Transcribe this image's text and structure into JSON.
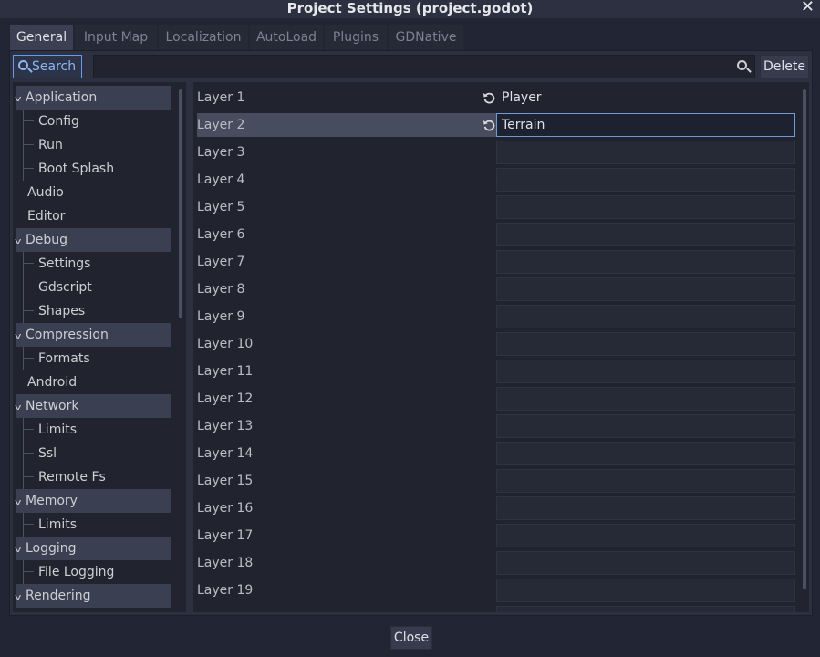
{
  "window": {
    "title": "Project Settings (project.godot)",
    "close_glyph": "✕"
  },
  "tabs": [
    {
      "label": "General"
    },
    {
      "label": "Input Map"
    },
    {
      "label": "Localization"
    },
    {
      "label": "AutoLoad"
    },
    {
      "label": "Plugins"
    },
    {
      "label": "GDNative"
    }
  ],
  "toolbar": {
    "search_label": "Search",
    "search_value": "",
    "delete_label": "Delete"
  },
  "tree": {
    "items": [
      {
        "label": "Application",
        "kind": "section"
      },
      {
        "label": "Config",
        "kind": "leaf"
      },
      {
        "label": "Run",
        "kind": "leaf"
      },
      {
        "label": "Boot Splash",
        "kind": "leaf"
      },
      {
        "label": "Audio",
        "kind": "top"
      },
      {
        "label": "Editor",
        "kind": "top"
      },
      {
        "label": "Debug",
        "kind": "section"
      },
      {
        "label": "Settings",
        "kind": "leaf"
      },
      {
        "label": "Gdscript",
        "kind": "leaf"
      },
      {
        "label": "Shapes",
        "kind": "leaf"
      },
      {
        "label": "Compression",
        "kind": "section"
      },
      {
        "label": "Formats",
        "kind": "leaf"
      },
      {
        "label": "Android",
        "kind": "top"
      },
      {
        "label": "Network",
        "kind": "section"
      },
      {
        "label": "Limits",
        "kind": "leaf"
      },
      {
        "label": "Ssl",
        "kind": "leaf"
      },
      {
        "label": "Remote Fs",
        "kind": "leaf"
      },
      {
        "label": "Memory",
        "kind": "section"
      },
      {
        "label": "Limits",
        "kind": "leaf"
      },
      {
        "label": "Logging",
        "kind": "section"
      },
      {
        "label": "File Logging",
        "kind": "leaf"
      },
      {
        "label": "Rendering",
        "kind": "section"
      }
    ]
  },
  "layers": {
    "rows": [
      {
        "label": "Layer 1",
        "value": "Player",
        "revert": true,
        "selected": false,
        "editing": false
      },
      {
        "label": "Layer 2",
        "value": "Terrain",
        "revert": true,
        "selected": true,
        "editing": true
      },
      {
        "label": "Layer 3",
        "value": "",
        "revert": false,
        "selected": false,
        "editing": false
      },
      {
        "label": "Layer 4",
        "value": "",
        "revert": false,
        "selected": false,
        "editing": false
      },
      {
        "label": "Layer 5",
        "value": "",
        "revert": false,
        "selected": false,
        "editing": false
      },
      {
        "label": "Layer 6",
        "value": "",
        "revert": false,
        "selected": false,
        "editing": false
      },
      {
        "label": "Layer 7",
        "value": "",
        "revert": false,
        "selected": false,
        "editing": false
      },
      {
        "label": "Layer 8",
        "value": "",
        "revert": false,
        "selected": false,
        "editing": false
      },
      {
        "label": "Layer 9",
        "value": "",
        "revert": false,
        "selected": false,
        "editing": false
      },
      {
        "label": "Layer 10",
        "value": "",
        "revert": false,
        "selected": false,
        "editing": false
      },
      {
        "label": "Layer 11",
        "value": "",
        "revert": false,
        "selected": false,
        "editing": false
      },
      {
        "label": "Layer 12",
        "value": "",
        "revert": false,
        "selected": false,
        "editing": false
      },
      {
        "label": "Layer 13",
        "value": "",
        "revert": false,
        "selected": false,
        "editing": false
      },
      {
        "label": "Layer 14",
        "value": "",
        "revert": false,
        "selected": false,
        "editing": false
      },
      {
        "label": "Layer 15",
        "value": "",
        "revert": false,
        "selected": false,
        "editing": false
      },
      {
        "label": "Layer 16",
        "value": "",
        "revert": false,
        "selected": false,
        "editing": false
      },
      {
        "label": "Layer 17",
        "value": "",
        "revert": false,
        "selected": false,
        "editing": false
      },
      {
        "label": "Layer 18",
        "value": "",
        "revert": false,
        "selected": false,
        "editing": false
      },
      {
        "label": "Layer 19",
        "value": "",
        "revert": false,
        "selected": false,
        "editing": false
      }
    ]
  },
  "footer": {
    "close_label": "Close"
  },
  "colors": {
    "accent": "#699ce8",
    "background": "#222533",
    "panel": "#2c3041"
  }
}
